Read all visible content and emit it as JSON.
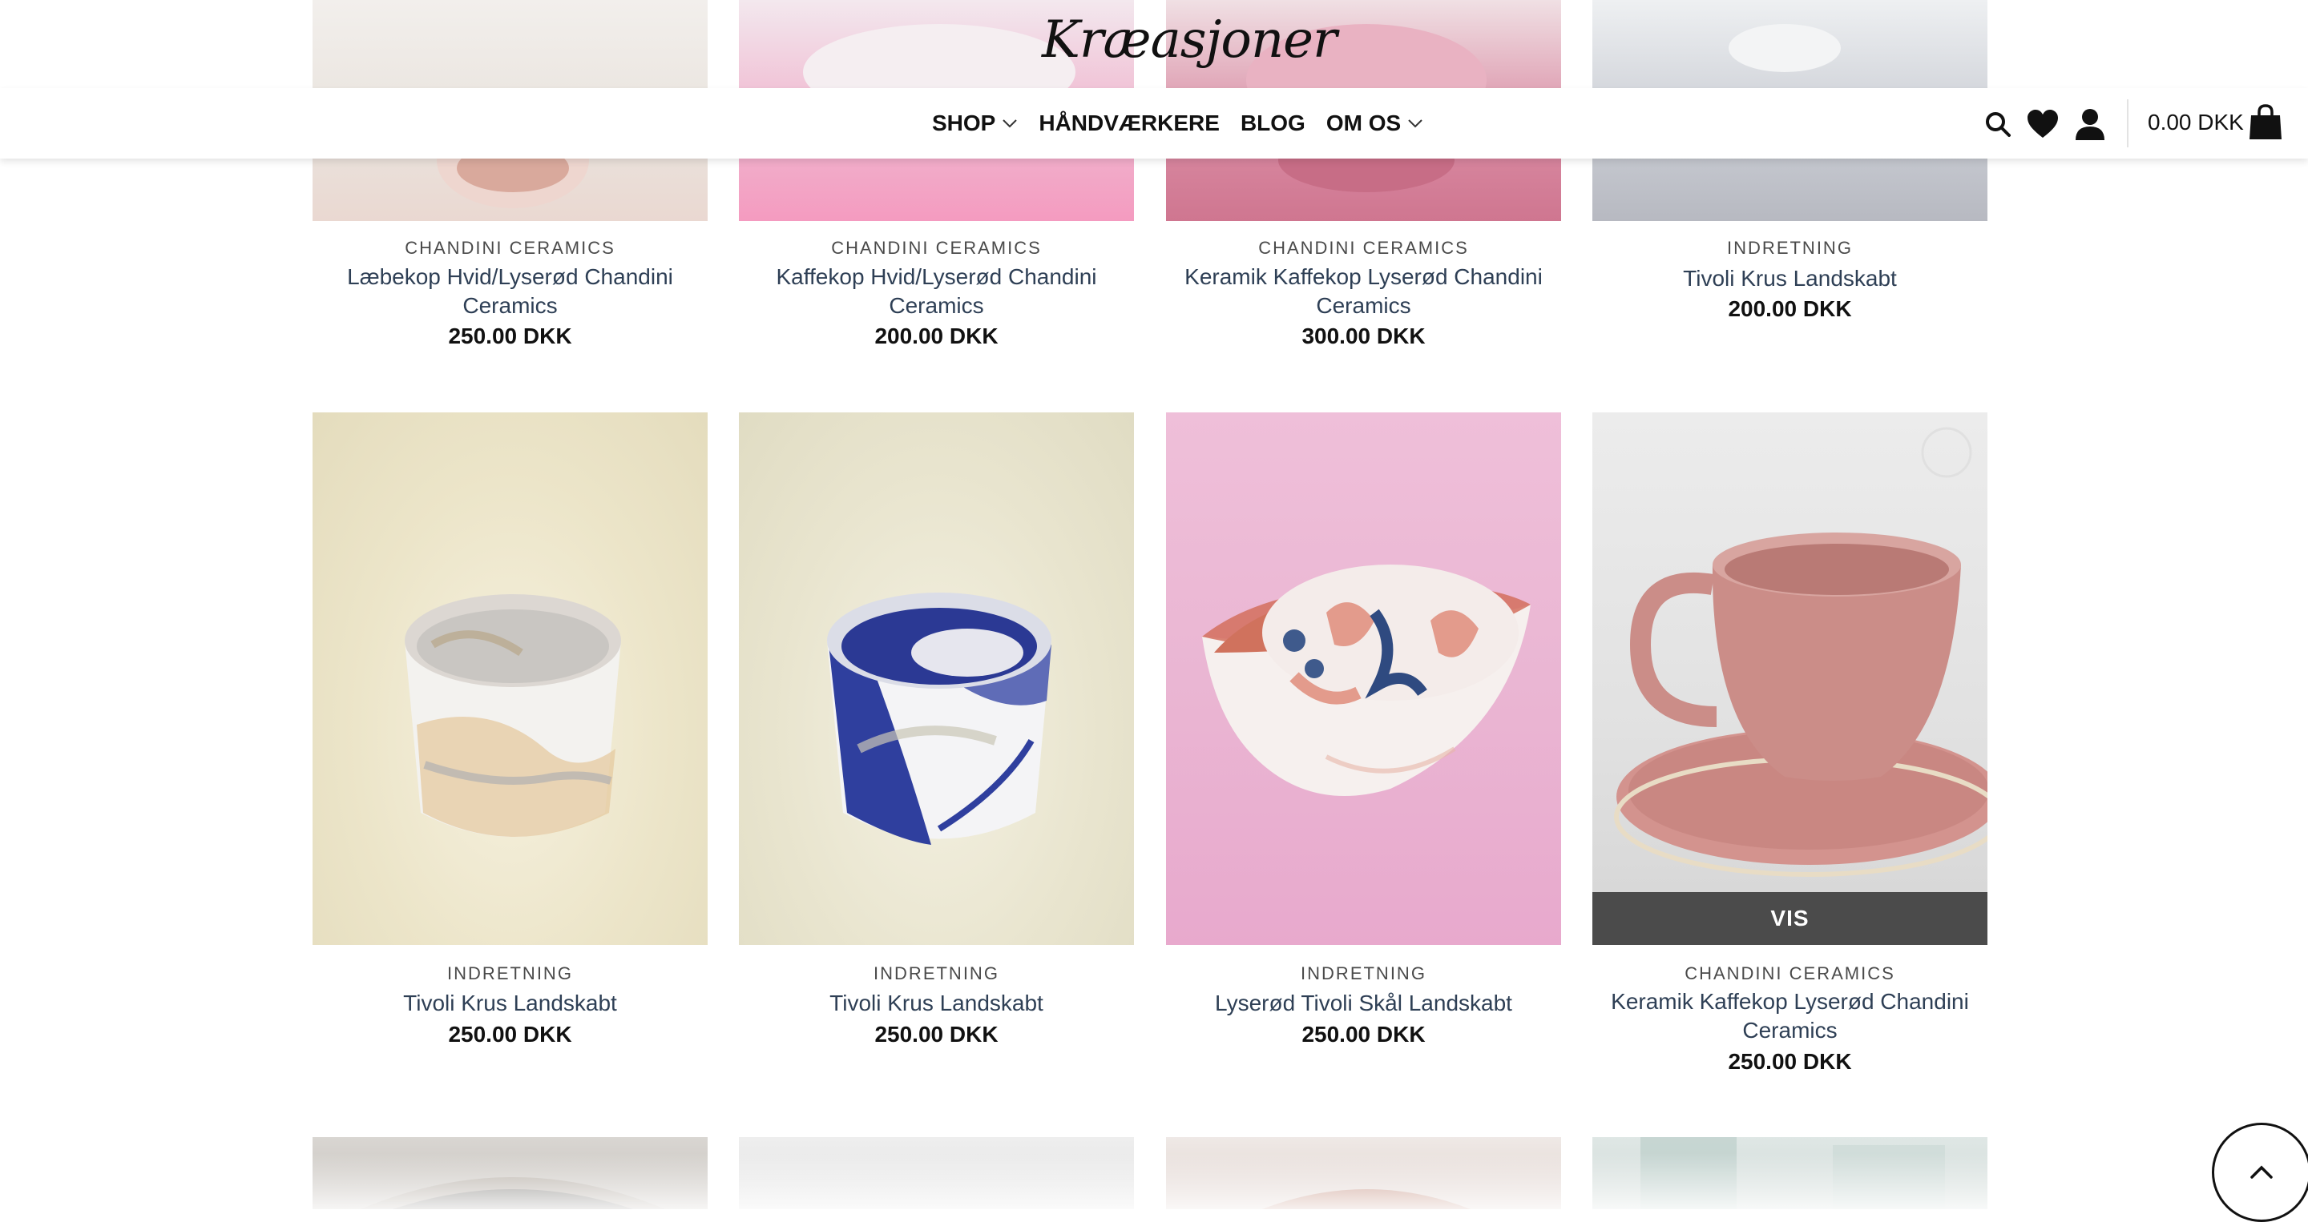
{
  "header": {
    "logo_text": "Kræasjoner",
    "nav": [
      {
        "label": "SHOP",
        "has_dropdown": true
      },
      {
        "label": "HÅNDVÆRKERE",
        "has_dropdown": false
      },
      {
        "label": "BLOG",
        "has_dropdown": false
      },
      {
        "label": "OM OS",
        "has_dropdown": true
      }
    ],
    "icons": [
      "search-icon",
      "heart-icon",
      "user-icon",
      "bag-icon"
    ],
    "cart_total": "0.00 DKK"
  },
  "products": {
    "row1": [
      {
        "category": "CHANDINI CERAMICS",
        "title": "Læbekop Hvid/Lyserød Chandini Ceramics",
        "title_lines": [
          "Læbekop Hvid/Lyserød Chandini",
          "Ceramics"
        ],
        "price": "250.00 DKK"
      },
      {
        "category": "CHANDINI CERAMICS",
        "title": "Kaffekop Hvid/Lyserød Chandini Ceramics",
        "title_lines": [
          "Kaffekop Hvid/Lyserød Chandini",
          "Ceramics"
        ],
        "price": "200.00 DKK"
      },
      {
        "category": "CHANDINI CERAMICS",
        "title": "Keramik Kaffekop Lyserød Chandini Ceramics",
        "title_lines": [
          "Keramik Kaffekop Lyserød Chandini",
          "Ceramics"
        ],
        "price": "300.00 DKK"
      },
      {
        "category": "INDRETNING",
        "title": "Tivoli Krus Landskabt",
        "title_lines": [
          "Tivoli Krus Landskabt"
        ],
        "price": "200.00 DKK"
      }
    ],
    "row2": [
      {
        "category": "INDRETNING",
        "title": "Tivoli Krus Landskabt",
        "title_lines": [
          "Tivoli Krus Landskabt"
        ],
        "price": "250.00 DKK"
      },
      {
        "category": "INDRETNING",
        "title": "Tivoli Krus Landskabt",
        "title_lines": [
          "Tivoli Krus Landskabt"
        ],
        "price": "250.00 DKK"
      },
      {
        "category": "INDRETNING",
        "title": "Lyserød Tivoli Skål Landskabt",
        "title_lines": [
          "Lyserød Tivoli Skål Landskabt"
        ],
        "price": "250.00 DKK"
      },
      {
        "category": "CHANDINI CERAMICS",
        "title": "Keramik Kaffekop Lyserød Chandini Ceramics",
        "title_lines": [
          "Keramik Kaffekop Lyserød Chandini",
          "Ceramics"
        ],
        "price": "250.00 DKK",
        "hover_button": "VIS"
      }
    ]
  },
  "colors": {
    "hover_bar": "#4b4b4b",
    "title_text": "#2e3f55",
    "category_text": "#4a4a4a",
    "price_text": "#111111"
  },
  "scroll_to_top_icon": "chevron-up-icon"
}
